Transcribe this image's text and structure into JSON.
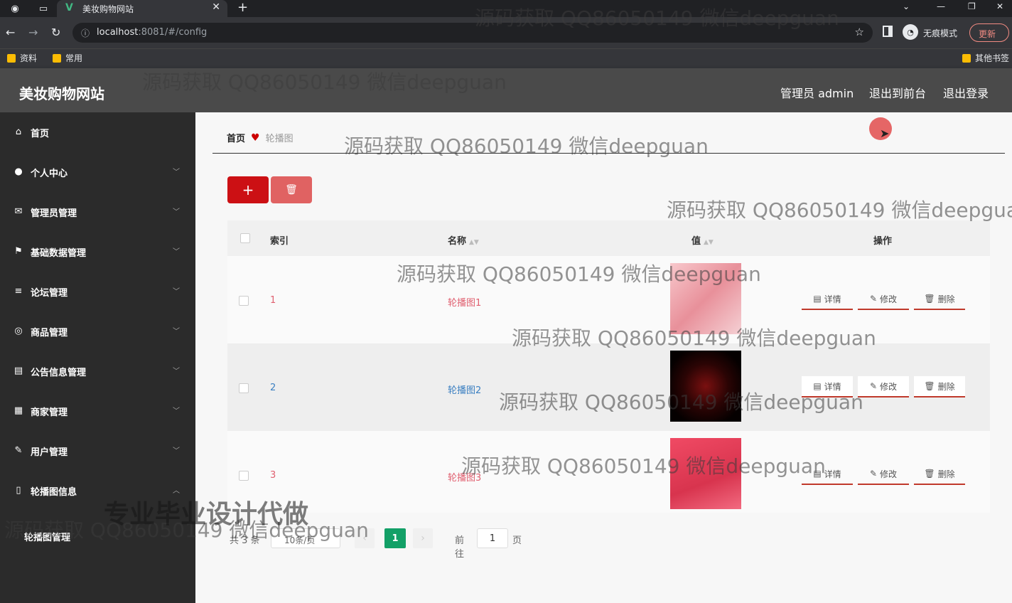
{
  "browser": {
    "tab_title": "美妆购物网站",
    "address_host": "localhost",
    "address_path": ":8081/#/config",
    "incognito_label": "无痕模式",
    "update_label": "更新",
    "bookmarks": [
      "资料",
      "常用"
    ],
    "other_bookmarks": "其他书签"
  },
  "header": {
    "brand": "美妆购物网站",
    "user": "管理员 admin",
    "to_front": "退出到前台",
    "logout": "退出登录"
  },
  "sidebar": {
    "items": [
      {
        "label": "首页",
        "icon": "home-icon"
      },
      {
        "label": "个人中心",
        "icon": "user-icon"
      },
      {
        "label": "管理员管理",
        "icon": "mail-icon"
      },
      {
        "label": "基础数据管理",
        "icon": "flag-icon"
      },
      {
        "label": "论坛管理",
        "icon": "list-icon"
      },
      {
        "label": "商品管理",
        "icon": "ring-icon"
      },
      {
        "label": "公告信息管理",
        "icon": "clipboard-icon"
      },
      {
        "label": "商家管理",
        "icon": "grid-icon"
      },
      {
        "label": "用户管理",
        "icon": "edit-icon"
      },
      {
        "label": "轮播图信息",
        "icon": "phone-icon"
      }
    ],
    "submenu_label": "轮播图管理"
  },
  "breadcrumb": {
    "home": "首页",
    "current": "轮播图"
  },
  "table": {
    "headers": {
      "index": "索引",
      "name": "名称",
      "value": "值",
      "actions": "操作"
    },
    "rows": [
      {
        "index": "1",
        "name": "轮播图1",
        "value_color": "#f0a0a8"
      },
      {
        "index": "2",
        "name": "轮播图2",
        "value_color": "#1a0505"
      },
      {
        "index": "3",
        "name": "轮播图3",
        "value_color": "#e8405a"
      }
    ],
    "actions": {
      "detail": "详情",
      "edit": "修改",
      "delete": "删除"
    }
  },
  "pager": {
    "total": "共 3 条",
    "page_size": "10条/页",
    "current_page": "1",
    "goto_label": "前往",
    "goto_value": "1",
    "goto_suffix": "页"
  },
  "watermarks": {
    "text": "源码获取 QQ86050149 微信deepguan",
    "promo": "专业毕业设计代做"
  }
}
